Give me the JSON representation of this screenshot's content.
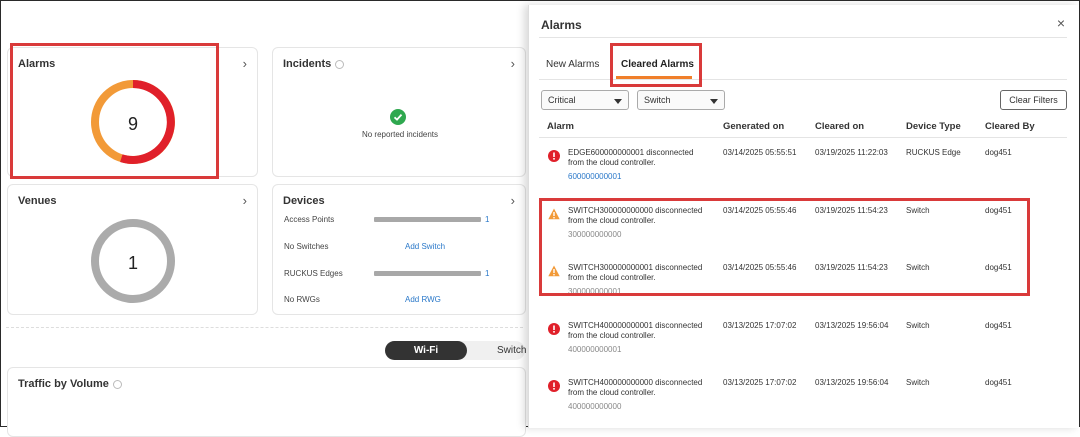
{
  "dashboard": {
    "alarms_card": {
      "title": "Alarms",
      "count": "9"
    },
    "incidents_card": {
      "title": "Incidents",
      "empty_text": "No reported incidents"
    },
    "venues_card": {
      "title": "Venues",
      "count": "1"
    },
    "devices_card": {
      "title": "Devices",
      "rows": [
        {
          "label": "Access Points",
          "value": "1"
        },
        {
          "label": "No Switches",
          "link": "Add Switch"
        },
        {
          "label": "RUCKUS Edges",
          "value": "1"
        },
        {
          "label": "No RWGs",
          "link": "Add RWG"
        }
      ]
    },
    "toggle": {
      "on": "Wi-Fi",
      "off": "Switch"
    },
    "traffic_card": {
      "title": "Traffic by Volume"
    }
  },
  "panel": {
    "title": "Alarms",
    "tabs": {
      "new": "New Alarms",
      "cleared": "Cleared Alarms"
    },
    "filters": {
      "severity": "Critical",
      "type": "Switch",
      "clear": "Clear Filters"
    },
    "columns": {
      "alarm": "Alarm",
      "generated": "Generated on",
      "cleared": "Cleared on",
      "device_type": "Device Type",
      "cleared_by": "Cleared By"
    },
    "rows": [
      {
        "severity": "critical",
        "msg_line1": "EDGE600000000001 disconnected",
        "msg_line2": "from the cloud controller.",
        "serial": "600000000001",
        "generated": "03/14/2025 05:55:51",
        "cleared": "03/19/2025 11:22:03",
        "device_type": "RUCKUS Edge",
        "cleared_by": "dog451"
      },
      {
        "severity": "warning",
        "msg_line1": "SWITCH300000000000 disconnected",
        "msg_line2": "from the cloud controller.",
        "serial": "300000000000",
        "generated": "03/14/2025 05:55:46",
        "cleared": "03/19/2025 11:54:23",
        "device_type": "Switch",
        "cleared_by": "dog451"
      },
      {
        "severity": "warning",
        "msg_line1": "SWITCH300000000001 disconnected",
        "msg_line2": "from the cloud controller.",
        "serial": "300000000001",
        "generated": "03/14/2025 05:55:46",
        "cleared": "03/19/2025 11:54:23",
        "device_type": "Switch",
        "cleared_by": "dog451"
      },
      {
        "severity": "critical",
        "msg_line1": "SWITCH400000000001 disconnected",
        "msg_line2": "from the cloud controller.",
        "serial": "400000000001",
        "generated": "03/13/2025 17:07:02",
        "cleared": "03/13/2025 19:56:04",
        "device_type": "Switch",
        "cleared_by": "dog451"
      },
      {
        "severity": "critical",
        "msg_line1": "SWITCH400000000000 disconnected",
        "msg_line2": "from the cloud controller.",
        "serial": "400000000000",
        "generated": "03/13/2025 17:07:02",
        "cleared": "03/13/2025 19:56:04",
        "device_type": "Switch",
        "cleared_by": "dog451"
      }
    ]
  },
  "colors": {
    "critical": "#e0202a",
    "warning": "#f29a38",
    "highlight": "#d93a3a",
    "tab_accent": "#f07f2a",
    "success": "#2fa84f",
    "link": "#2a78c9"
  },
  "icons": [
    "chevron-right-icon",
    "info-icon",
    "check-circle-icon",
    "close-icon",
    "caret-down-icon",
    "critical-alert-icon",
    "warning-triangle-icon"
  ]
}
